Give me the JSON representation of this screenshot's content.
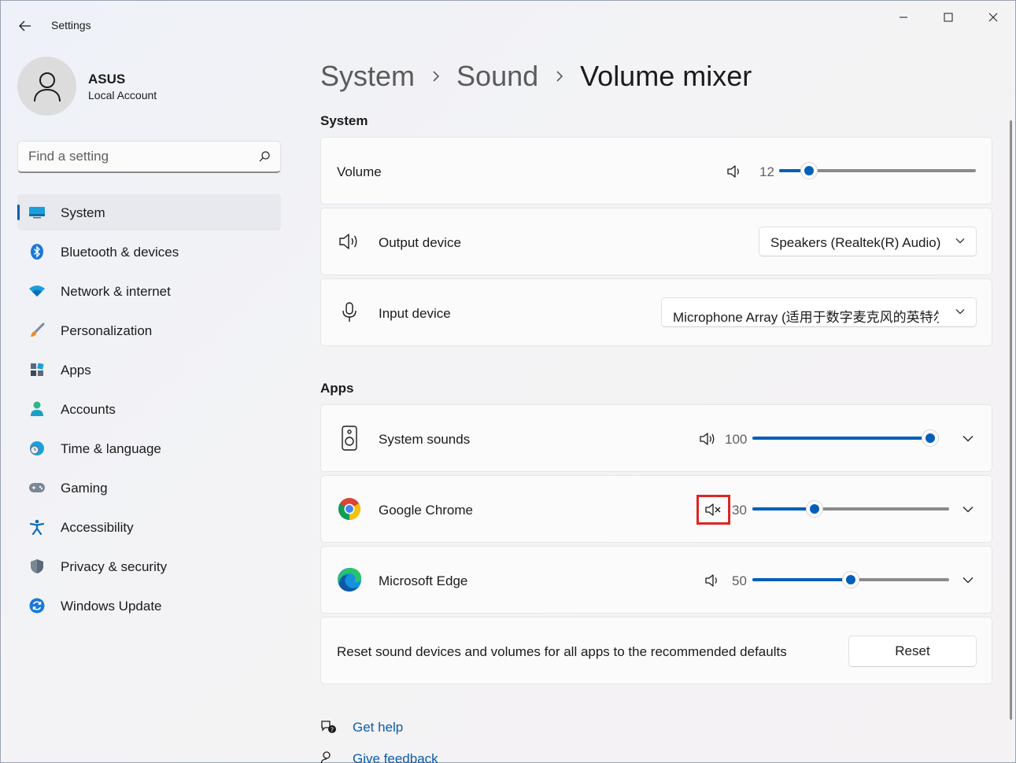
{
  "window": {
    "title": "Settings"
  },
  "user": {
    "name": "ASUS",
    "account_type": "Local Account"
  },
  "search": {
    "placeholder": "Find a setting"
  },
  "sidebar": {
    "items": [
      {
        "label": "System",
        "icon": "system-icon",
        "active": true
      },
      {
        "label": "Bluetooth & devices",
        "icon": "bluetooth-icon"
      },
      {
        "label": "Network & internet",
        "icon": "wifi-icon"
      },
      {
        "label": "Personalization",
        "icon": "brush-icon"
      },
      {
        "label": "Apps",
        "icon": "apps-icon"
      },
      {
        "label": "Accounts",
        "icon": "accounts-icon"
      },
      {
        "label": "Time & language",
        "icon": "globe-clock-icon"
      },
      {
        "label": "Gaming",
        "icon": "gamepad-icon"
      },
      {
        "label": "Accessibility",
        "icon": "accessibility-icon"
      },
      {
        "label": "Privacy & security",
        "icon": "shield-icon"
      },
      {
        "label": "Windows Update",
        "icon": "update-icon"
      }
    ]
  },
  "breadcrumb": [
    "System",
    "Sound",
    "Volume mixer"
  ],
  "system_section": {
    "title": "System",
    "volume": {
      "label": "Volume",
      "value": "12",
      "level": 12
    },
    "output": {
      "label": "Output device",
      "selected": "Speakers (Realtek(R) Audio)"
    },
    "input": {
      "label": "Input device",
      "selected": "Microphone Array (适用于数字麦克风的英特尔® 智音技术)"
    }
  },
  "apps_section": {
    "title": "Apps",
    "apps": [
      {
        "name": "System sounds",
        "value": "100",
        "level": 100,
        "muted": false,
        "icon": "speaker-box-icon"
      },
      {
        "name": "Google Chrome",
        "value": "30",
        "level": 30,
        "muted": true,
        "icon": "chrome-icon"
      },
      {
        "name": "Microsoft Edge",
        "value": "50",
        "level": 50,
        "muted": false,
        "icon": "edge-icon"
      }
    ]
  },
  "reset": {
    "description": "Reset sound devices and volumes for all apps to the recommended defaults",
    "button_label": "Reset"
  },
  "footer_links": {
    "help": "Get help",
    "feedback": "Give feedback"
  },
  "colors": {
    "accent": "#005fb8",
    "highlight": "#e02424"
  }
}
